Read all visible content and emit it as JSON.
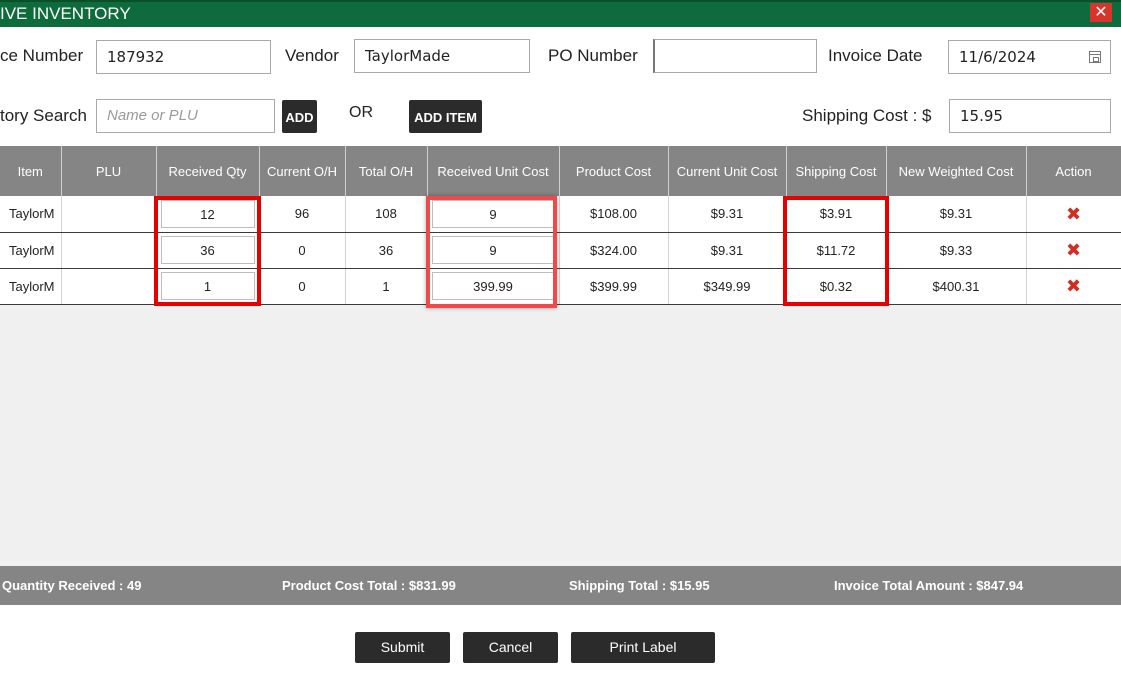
{
  "window": {
    "title": "IVE INVENTORY",
    "close_glyph": "✕"
  },
  "form": {
    "invoice_number_label": "ce Number",
    "invoice_number_value": "187932",
    "vendor_label": "Vendor",
    "vendor_value": "TaylorMade",
    "po_number_label": "PO Number",
    "po_number_value": "",
    "invoice_date_label": "Invoice Date",
    "invoice_date_value": "11/6/2024",
    "inventory_search_label": "tory Search",
    "inventory_search_placeholder": "Name or PLU",
    "add_label": "ADD",
    "or_label": "OR",
    "add_item_label": "ADD ITEM",
    "shipping_cost_label": "Shipping Cost : $",
    "shipping_cost_value": "15.95"
  },
  "table": {
    "columns": [
      "Item",
      "PLU",
      "Received Qty",
      "Current O/H",
      "Total O/H",
      "Received Unit Cost",
      "Product Cost",
      "Current Unit Cost",
      "Shipping Cost",
      "New Weighted Cost",
      "Action"
    ],
    "rows": [
      [
        "TaylorM",
        "",
        "12",
        "96",
        "108",
        "9",
        "$108.00",
        "$9.31",
        "$3.91",
        "$9.31"
      ],
      [
        "TaylorM",
        "",
        "36",
        "0",
        "36",
        "9",
        "$324.00",
        "$9.31",
        "$11.72",
        "$9.33"
      ],
      [
        "TaylorM",
        "",
        "1",
        "0",
        "1",
        "399.99",
        "$399.99",
        "$349.99",
        "$0.32",
        "$400.31"
      ]
    ],
    "delete_glyph": "✖"
  },
  "summary": {
    "quantity_received": "Quantity Received : 49",
    "product_cost_total": "Product Cost Total : $831.99",
    "shipping_total": "Shipping Total : $15.95",
    "invoice_total": "Invoice Total Amount : $847.94"
  },
  "buttons": {
    "submit": "Submit",
    "cancel": "Cancel",
    "print_label": "Print Label"
  },
  "colors": {
    "title_bar": "#0e6b3b",
    "header_gray": "#858585",
    "highlight_red": "#e60000",
    "delete_red": "#d62b21"
  }
}
